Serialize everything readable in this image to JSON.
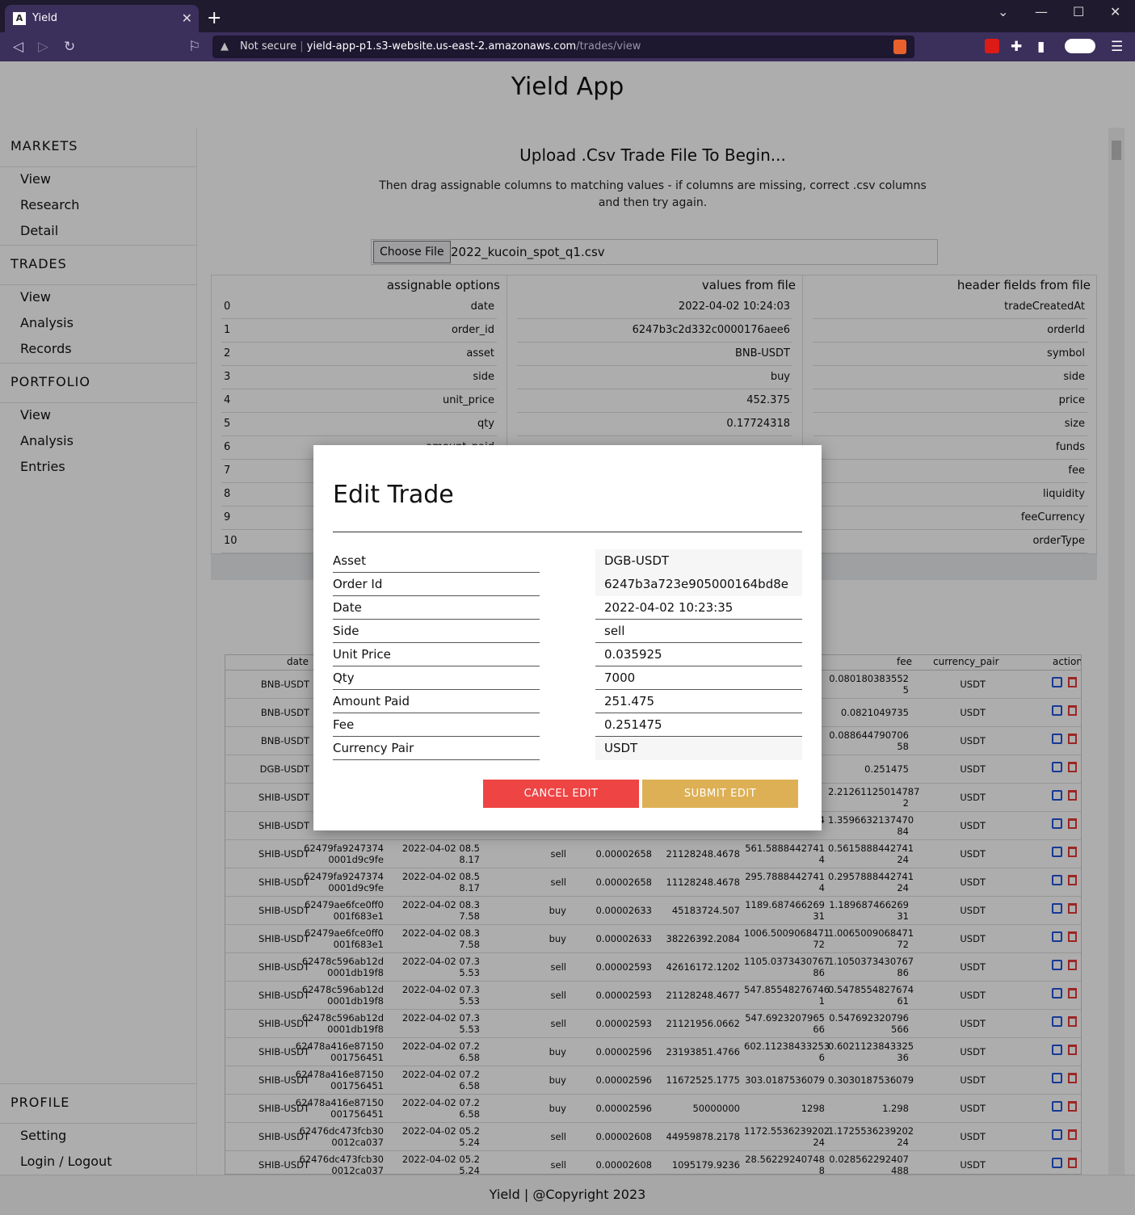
{
  "browser": {
    "tab_title": "Yield",
    "tab_close": "✕",
    "new_tab": "+",
    "security": "Not secure",
    "url_host": "yield-app-p1.s3-website.us-east-2.amazonaws.com",
    "url_path": "/trades/view"
  },
  "app": {
    "title": "Yield App"
  },
  "sidebar": {
    "markets": {
      "title": "MARKETS",
      "items": [
        "View",
        "Research",
        "Detail"
      ]
    },
    "trades": {
      "title": "TRADES",
      "items": [
        "View",
        "Analysis",
        "Records"
      ]
    },
    "portfolio": {
      "title": "PORTFOLIO",
      "items": [
        "View",
        "Analysis",
        "Entries"
      ]
    },
    "profile": {
      "title": "PROFILE",
      "items": [
        "Setting",
        "Login / Logout"
      ]
    }
  },
  "upload": {
    "heading": "Upload .Csv Trade File To Begin...",
    "subtext": "Then drag assignable columns to matching values - if columns are missing, correct .csv columns and then try again.",
    "choose_file": "Choose File",
    "file_name": "2022_kucoin_spot_q1.csv"
  },
  "mapping": {
    "headers": {
      "options": "assignable options",
      "values": "values from file",
      "fields": "header fields from file"
    },
    "options": [
      {
        "idx": "0",
        "name": "date"
      },
      {
        "idx": "1",
        "name": "order_id"
      },
      {
        "idx": "2",
        "name": "asset"
      },
      {
        "idx": "3",
        "name": "side"
      },
      {
        "idx": "4",
        "name": "unit_price"
      },
      {
        "idx": "5",
        "name": "qty"
      },
      {
        "idx": "6",
        "name": "amount_paid"
      },
      {
        "idx": "7",
        "name": ""
      },
      {
        "idx": "8",
        "name": ""
      },
      {
        "idx": "9",
        "name": ""
      },
      {
        "idx": "10",
        "name": ""
      }
    ],
    "values": [
      "2022-04-02 10:24:03",
      "6247b3c2d332c0000176aee6",
      "BNB-USDT",
      "buy",
      "452.375",
      "0.17724318",
      "",
      "",
      "",
      "",
      ""
    ],
    "fields": [
      "tradeCreatedAt",
      "orderId",
      "symbol",
      "side",
      "price",
      "size",
      "funds",
      "fee",
      "liquidity",
      "feeCurrency",
      "orderType"
    ]
  },
  "table": {
    "headers": {
      "date": "date",
      "fee": "fee",
      "currency_pair": "currency_pair",
      "action": "action"
    },
    "rows": [
      {
        "asset": "BNB-USDT",
        "order_id": [
          "",
          ""
        ],
        "date": [
          "",
          ""
        ],
        "side": "",
        "price": "",
        "qty": "",
        "amount": [
          "",
          ""
        ],
        "fee": [
          "0.080180383552",
          "5"
        ],
        "pair": "USDT"
      },
      {
        "asset": "BNB-USDT",
        "order_id": [
          "",
          ""
        ],
        "date": [
          "",
          ""
        ],
        "side": "",
        "price": "",
        "qty": "",
        "amount": [
          "",
          ""
        ],
        "fee": [
          "0.0821049735",
          ""
        ],
        "pair": "USDT"
      },
      {
        "asset": "BNB-USDT",
        "order_id": [
          "",
          ""
        ],
        "date": [
          "",
          ""
        ],
        "side": "",
        "price": "",
        "qty": "",
        "amount": [
          "",
          ""
        ],
        "fee": [
          "0.088644790706",
          "58"
        ],
        "pair": "USDT"
      },
      {
        "asset": "DGB-USDT",
        "order_id": [
          "",
          ""
        ],
        "date": [
          "",
          ""
        ],
        "side": "",
        "price": "",
        "qty": "",
        "amount": [
          "",
          ""
        ],
        "fee": [
          "0.251475",
          ""
        ],
        "pair": "USDT"
      },
      {
        "asset": "SHIB-USDT",
        "order_id": [
          "",
          ""
        ],
        "date": [
          "",
          ""
        ],
        "side": "",
        "price": "",
        "qty": "",
        "amount": [
          "",
          ""
        ],
        "fee": [
          "2.21261125014787",
          "2"
        ],
        "pair": "USDT"
      },
      {
        "asset": "SHIB-USDT",
        "order_id": [
          "",
          "0001d9c9fe"
        ],
        "date": [
          "",
          "8.17"
        ],
        "side": "",
        "price": "",
        "qty": "",
        "amount": [
          "",
          "84"
        ],
        "fee": [
          "1.3596632137470",
          "84"
        ],
        "pair": "USDT"
      },
      {
        "asset": "SHIB-USDT",
        "order_id": [
          "62479fa9247374",
          "0001d9c9fe"
        ],
        "date": [
          "2022-04-02 08.5",
          "8.17"
        ],
        "side": "sell",
        "price": "0.00002658",
        "qty": "21128248.4678",
        "amount": [
          "561.5888442741",
          "4"
        ],
        "fee": [
          "0.5615888442741",
          "24"
        ],
        "pair": "USDT"
      },
      {
        "asset": "SHIB-USDT",
        "order_id": [
          "62479fa9247374",
          "0001d9c9fe"
        ],
        "date": [
          "2022-04-02 08.5",
          "8.17"
        ],
        "side": "sell",
        "price": "0.00002658",
        "qty": "11128248.4678",
        "amount": [
          "295.7888442741",
          "4"
        ],
        "fee": [
          "0.2957888442741",
          "24"
        ],
        "pair": "USDT"
      },
      {
        "asset": "SHIB-USDT",
        "order_id": [
          "62479ae6fce0ff0",
          "001f683e1"
        ],
        "date": [
          "2022-04-02 08.3",
          "7.58"
        ],
        "side": "buy",
        "price": "0.00002633",
        "qty": "45183724.507",
        "amount": [
          "1189.687466269",
          "31"
        ],
        "fee": [
          "1.189687466269",
          "31"
        ],
        "pair": "USDT"
      },
      {
        "asset": "SHIB-USDT",
        "order_id": [
          "62479ae6fce0ff0",
          "001f683e1"
        ],
        "date": [
          "2022-04-02 08.3",
          "7.58"
        ],
        "side": "buy",
        "price": "0.00002633",
        "qty": "38226392.2084",
        "amount": [
          "1006.5009068471",
          "72"
        ],
        "fee": [
          "1.0065009068471",
          "72"
        ],
        "pair": "USDT"
      },
      {
        "asset": "SHIB-USDT",
        "order_id": [
          "62478c596ab12d",
          "0001db19f8"
        ],
        "date": [
          "2022-04-02 07.3",
          "5.53"
        ],
        "side": "sell",
        "price": "0.00002593",
        "qty": "42616172.1202",
        "amount": [
          "1105.0373430767",
          "86"
        ],
        "fee": [
          "1.1050373430767",
          "86"
        ],
        "pair": "USDT"
      },
      {
        "asset": "SHIB-USDT",
        "order_id": [
          "62478c596ab12d",
          "0001db19f8"
        ],
        "date": [
          "2022-04-02 07.3",
          "5.53"
        ],
        "side": "sell",
        "price": "0.00002593",
        "qty": "21128248.4677",
        "amount": [
          "547.85548276746",
          "1"
        ],
        "fee": [
          "0.5478554827674",
          "61"
        ],
        "pair": "USDT"
      },
      {
        "asset": "SHIB-USDT",
        "order_id": [
          "62478c596ab12d",
          "0001db19f8"
        ],
        "date": [
          "2022-04-02 07.3",
          "5.53"
        ],
        "side": "sell",
        "price": "0.00002593",
        "qty": "21121956.0662",
        "amount": [
          "547.6923207965",
          "66"
        ],
        "fee": [
          "0.547692320796",
          "566"
        ],
        "pair": "USDT"
      },
      {
        "asset": "SHIB-USDT",
        "order_id": [
          "62478a416e87150",
          "001756451"
        ],
        "date": [
          "2022-04-02 07.2",
          "6.58"
        ],
        "side": "buy",
        "price": "0.00002596",
        "qty": "23193851.4766",
        "amount": [
          "602.11238433253",
          "6"
        ],
        "fee": [
          "0.6021123843325",
          "36"
        ],
        "pair": "USDT"
      },
      {
        "asset": "SHIB-USDT",
        "order_id": [
          "62478a416e87150",
          "001756451"
        ],
        "date": [
          "2022-04-02 07.2",
          "6.58"
        ],
        "side": "buy",
        "price": "0.00002596",
        "qty": "11672525.1775",
        "amount": [
          "303.0187536079",
          ""
        ],
        "fee": [
          "0.3030187536079",
          ""
        ],
        "pair": "USDT"
      },
      {
        "asset": "SHIB-USDT",
        "order_id": [
          "62478a416e87150",
          "001756451"
        ],
        "date": [
          "2022-04-02 07.2",
          "6.58"
        ],
        "side": "buy",
        "price": "0.00002596",
        "qty": "50000000",
        "amount": [
          "1298",
          ""
        ],
        "fee": [
          "1.298",
          ""
        ],
        "pair": "USDT"
      },
      {
        "asset": "SHIB-USDT",
        "order_id": [
          "62476dc473fcb30",
          "0012ca037"
        ],
        "date": [
          "2022-04-02 05.2",
          "5.24"
        ],
        "side": "sell",
        "price": "0.00002608",
        "qty": "44959878.2178",
        "amount": [
          "1172.5536239202",
          "24"
        ],
        "fee": [
          "1.1725536239202",
          "24"
        ],
        "pair": "USDT"
      },
      {
        "asset": "SHIB-USDT",
        "order_id": [
          "62476dc473fcb30",
          "0012ca037"
        ],
        "date": [
          "2022-04-02 05.2",
          "5.24"
        ],
        "side": "sell",
        "price": "0.00002608",
        "qty": "1095179.9236",
        "amount": [
          "28.56229240748",
          "8"
        ],
        "fee": [
          "0.028562292407",
          "488"
        ],
        "pair": "USDT"
      }
    ]
  },
  "footer": {
    "text": "Yield | @Copyright 2023"
  },
  "modal": {
    "title": "Edit Trade",
    "fields": [
      {
        "label": "Asset",
        "value": "DGB-USDT"
      },
      {
        "label": "Order Id",
        "value": "6247b3a723e905000164bd8e"
      },
      {
        "label": "Date",
        "value": "2022-04-02 10:23:35"
      },
      {
        "label": "Side",
        "value": "sell"
      },
      {
        "label": "Unit Price",
        "value": "0.035925"
      },
      {
        "label": "Qty",
        "value": "7000"
      },
      {
        "label": "Amount Paid",
        "value": "251.475"
      },
      {
        "label": "Fee",
        "value": "0.251475"
      },
      {
        "label": "Currency Pair",
        "value": "USDT"
      }
    ],
    "cancel_label": "CANCEL EDIT",
    "submit_label": "SUBMIT EDIT"
  }
}
